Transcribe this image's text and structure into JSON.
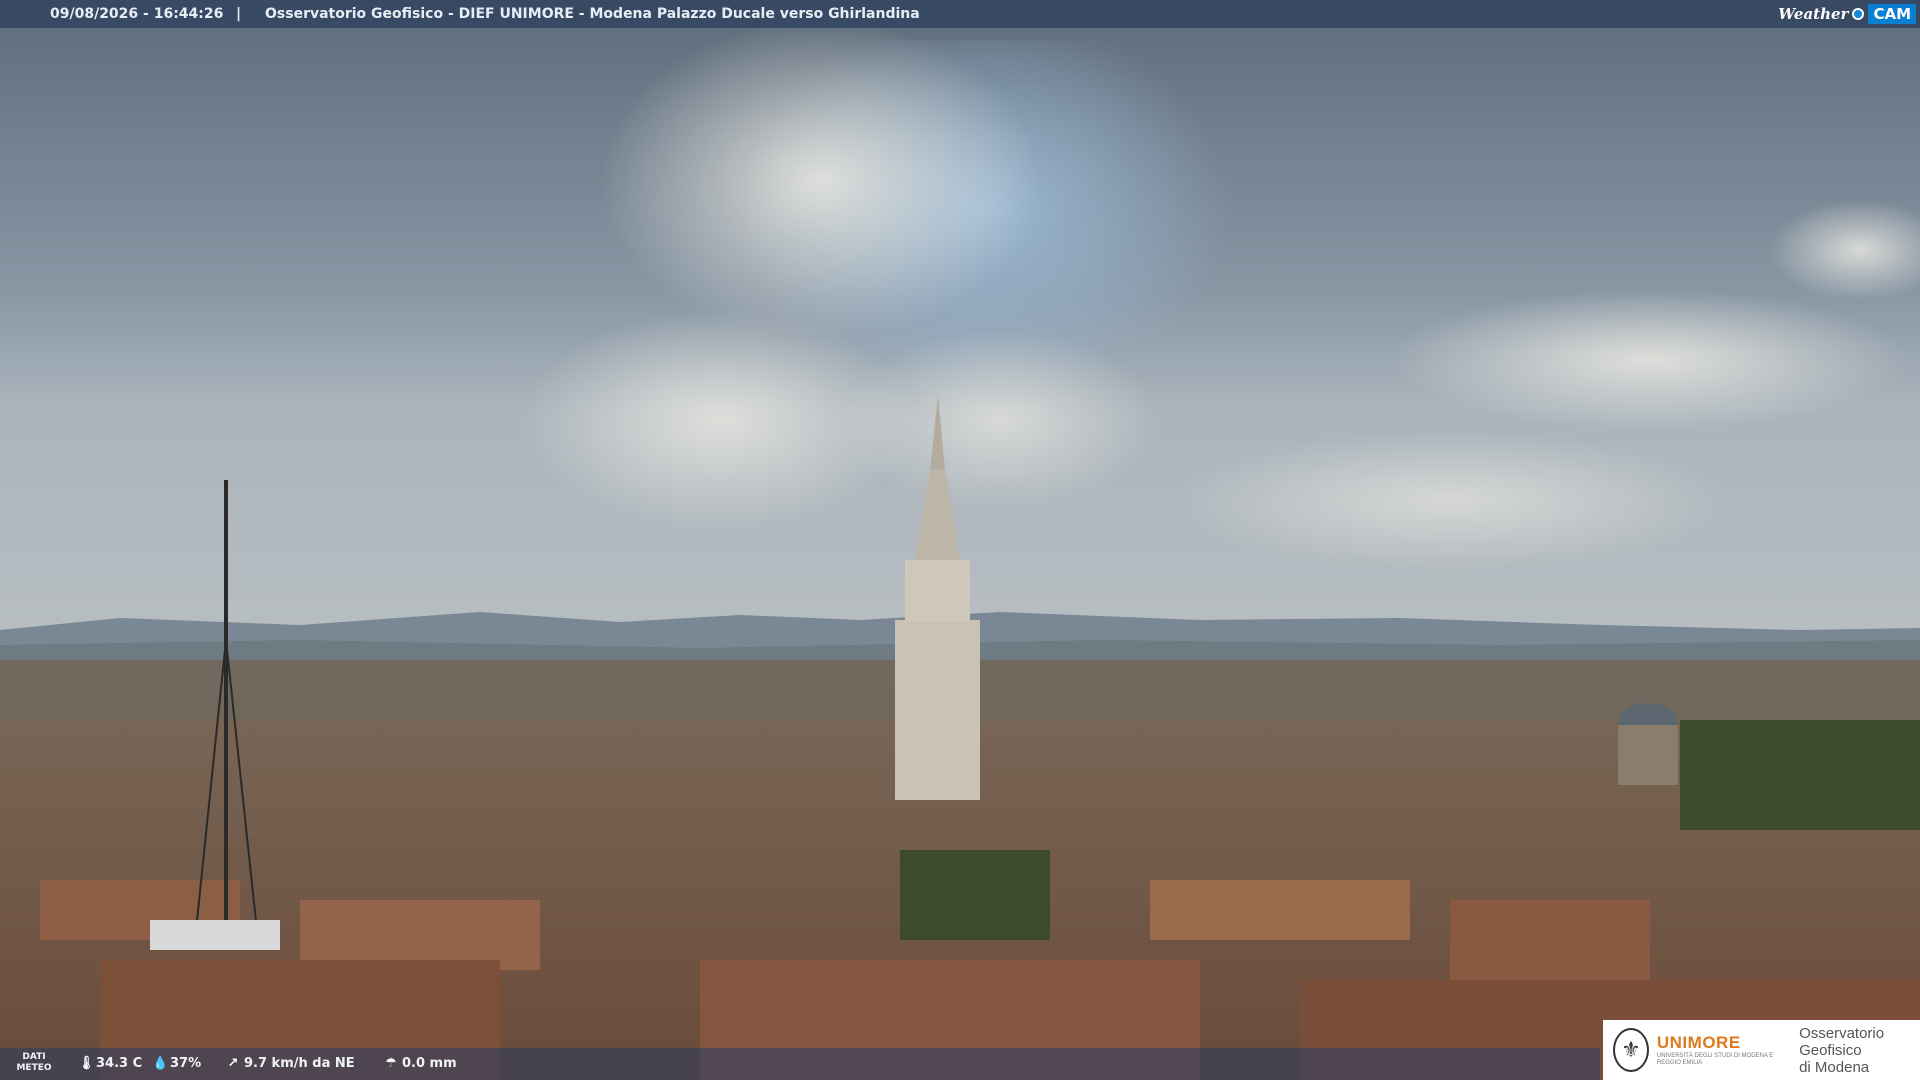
{
  "header": {
    "timestamp": "09/08/2026 - 16:44:26",
    "separator": "|",
    "title": "Osservatorio Geofisico - DIEF UNIMORE - Modena Palazzo Ducale verso Ghirlandina"
  },
  "brand": {
    "weather_text": "Weather",
    "cam_text": "CAM"
  },
  "weather_data": {
    "label": "DATI METEO",
    "temperature": "34.3 C",
    "humidity": "37%",
    "wind": "9.7 km/h da NE",
    "rain": "0.0 mm",
    "icons": {
      "temperature": "thermometer-icon",
      "humidity": "droplet-icon",
      "wind": "wind-icon",
      "rain": "rain-icon"
    }
  },
  "footer_logo": {
    "unimore": "UNIMORE",
    "unimore_sub": "UNIVERSITÀ DEGLI STUDI DI MODENA E REGGIO EMILIA",
    "observatory_line1": "Osservatorio Geofisico",
    "observatory_line2": "di Modena"
  },
  "colors": {
    "sky_top": "#6f7d8c",
    "sky_blue": "#8fb0cc",
    "roof": "#8a5a42",
    "tower": "#c9c3b6",
    "bar": "#283c5a",
    "brand_blue": "#0b7fd1",
    "unimore_orange": "#e07a1c"
  }
}
